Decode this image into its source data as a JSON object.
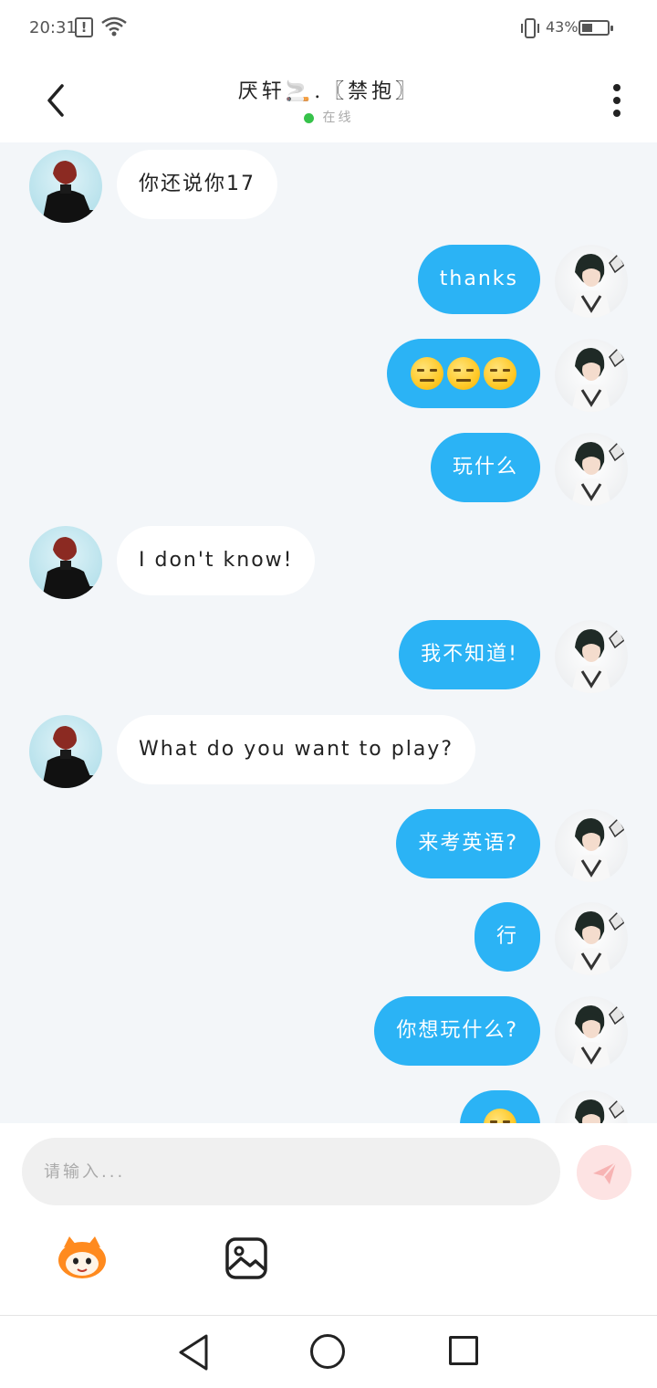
{
  "status_bar": {
    "time": "20:31",
    "battery_percent": "43%",
    "battery_level": 0.43,
    "icons": [
      "alert-icon",
      "wifi-icon",
      "vibrate-icon",
      "battery-icon"
    ]
  },
  "header": {
    "title": "厌轩🚬.〖禁抱〗",
    "status": "在线",
    "status_color": "#36c24a",
    "icons": [
      "back-icon",
      "more-icon"
    ]
  },
  "messages": [
    {
      "from": "other",
      "text": "你还说你17"
    },
    {
      "from": "self",
      "text": "thanks"
    },
    {
      "from": "self",
      "text": "",
      "emoji": [
        "expressionless",
        "expressionless",
        "expressionless"
      ]
    },
    {
      "from": "self",
      "text": "玩什么"
    },
    {
      "from": "other",
      "text": "I don't know!"
    },
    {
      "from": "self",
      "text": "我不知道!"
    },
    {
      "from": "other",
      "text": "What do you want to play?"
    },
    {
      "from": "self",
      "text": "来考英语?"
    },
    {
      "from": "self",
      "text": "行"
    },
    {
      "from": "self",
      "text": "你想玩什么?"
    },
    {
      "from": "self",
      "text": "",
      "emoji": [
        "expressionless"
      ],
      "partially_visible": true
    }
  ],
  "composer": {
    "placeholder": "请输入...",
    "value": "",
    "icons": [
      "send-icon",
      "sticker-icon",
      "image-icon"
    ],
    "send_color": "#fde3e3"
  },
  "nav_bar": {
    "icons": [
      "nav-back-icon",
      "nav-home-icon",
      "nav-recent-icon"
    ]
  },
  "colors": {
    "self_bubble": "#2bb3f5",
    "other_bubble": "#ffffff",
    "chat_background": "#f3f6f9"
  }
}
